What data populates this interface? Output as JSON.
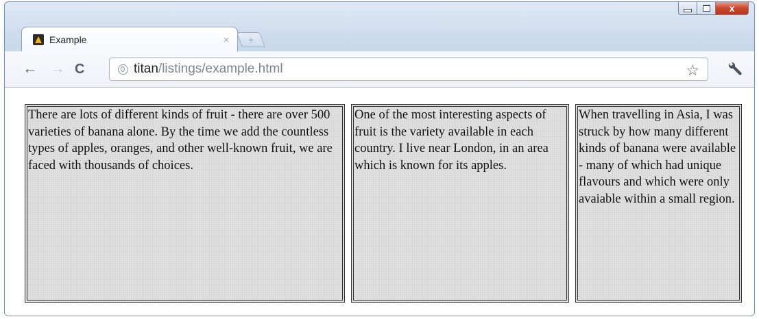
{
  "window": {
    "controls": {
      "minimize": "minimize",
      "maximize": "maximize",
      "close": "x"
    }
  },
  "tab": {
    "title": "Example",
    "close_glyph": "×",
    "favicon": "app-favicon",
    "newtab_glyph": "+"
  },
  "toolbar": {
    "back_glyph": "←",
    "forward_glyph": "→",
    "reload_glyph": "C",
    "url_host": "titan",
    "url_path": "/listings/example.html",
    "star_glyph": "☆"
  },
  "content": {
    "columns": [
      {
        "text": "There are lots of different kinds of fruit - there are over 500 varieties of banana alone. By the time we add the countless types of apples, oranges, and other well-known fruit, we are faced with thousands of choices."
      },
      {
        "text": "One of the most interesting aspects of fruit is the variety available in each country. I live near London, in an area which is known for its apples."
      },
      {
        "text": "When travelling in Asia, I was struck by how many different kinds of banana were available - many of which had unique flavours and which were only avaiable within a small region."
      }
    ]
  },
  "colors": {
    "column_bg": "#d8d8d8",
    "column_border": "#333333",
    "chrome_frame": "#c9d9ec",
    "close_button": "#c8492e"
  }
}
